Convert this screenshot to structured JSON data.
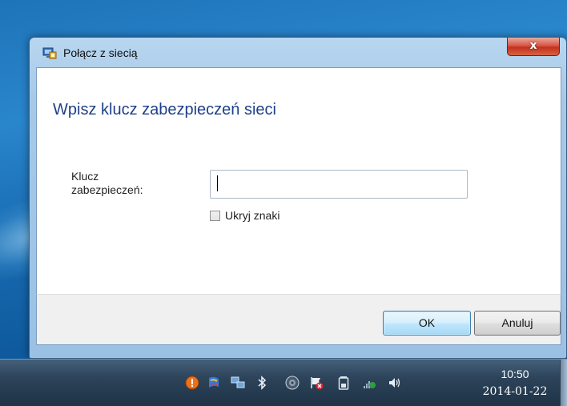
{
  "dialog": {
    "title": "Połącz z siecią",
    "close_glyph": "x",
    "heading": "Wpisz klucz zabezpieczeń sieci",
    "field_label": "Klucz zabezpieczeń:",
    "field_value": "",
    "hide_chars_label": "Ukryj znaki",
    "hide_chars_checked": false,
    "ok_label": "OK",
    "cancel_label": "Anuluj"
  },
  "taskbar": {
    "tray_icons": [
      "warning-icon",
      "flag-icon",
      "network-icon",
      "bluetooth-icon",
      "disc-icon",
      "action-center-icon",
      "battery-icon",
      "wifi-icon",
      "volume-icon"
    ],
    "time": "10:50",
    "date": "2014-01-22"
  },
  "colors": {
    "heading": "#1e3f8a",
    "close_button": "#c2321f",
    "ok_button_border": "#3c7fb1",
    "taskbar": "#2c4359"
  }
}
